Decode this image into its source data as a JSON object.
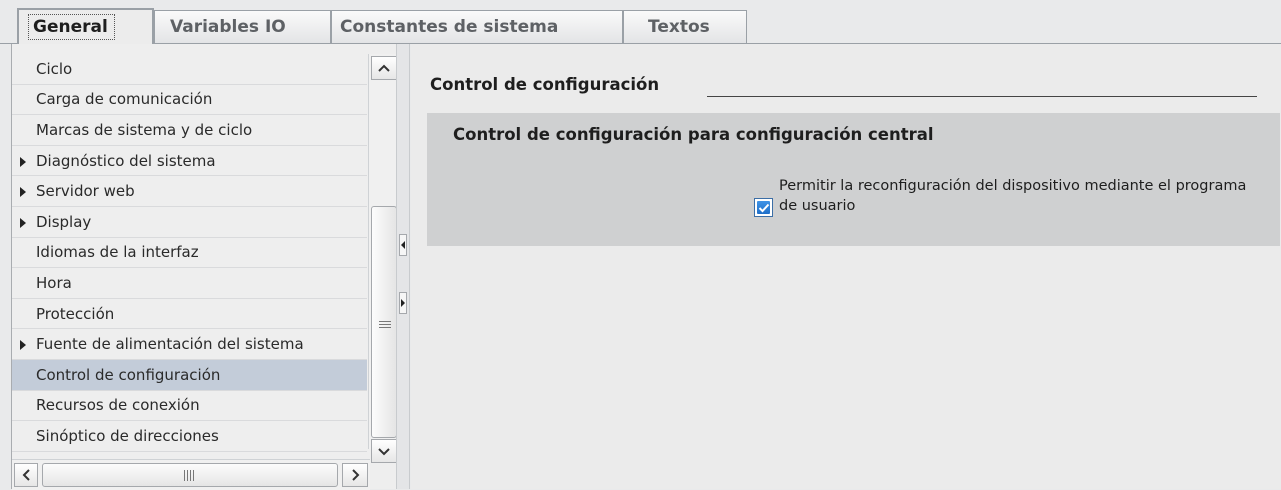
{
  "tabs": [
    {
      "label": "General",
      "active": true
    },
    {
      "label": "Variables IO",
      "active": false
    },
    {
      "label": "Constantes de sistema",
      "active": false
    },
    {
      "label": "Textos",
      "active": false
    }
  ],
  "nav": {
    "items": [
      {
        "label": "Ciclo",
        "expandable": false,
        "selected": false
      },
      {
        "label": "Carga de comunicación",
        "expandable": false,
        "selected": false
      },
      {
        "label": "Marcas de sistema y de ciclo",
        "expandable": false,
        "selected": false
      },
      {
        "label": "Diagnóstico del sistema",
        "expandable": true,
        "selected": false
      },
      {
        "label": "Servidor web",
        "expandable": true,
        "selected": false
      },
      {
        "label": "Display",
        "expandable": true,
        "selected": false
      },
      {
        "label": "Idiomas de la interfaz",
        "expandable": false,
        "selected": false
      },
      {
        "label": "Hora",
        "expandable": false,
        "selected": false
      },
      {
        "label": "Protección",
        "expandable": false,
        "selected": false
      },
      {
        "label": "Fuente de alimentación del sistema",
        "expandable": true,
        "selected": false
      },
      {
        "label": "Control de configuración",
        "expandable": false,
        "selected": true
      },
      {
        "label": "Recursos de conexión",
        "expandable": false,
        "selected": false
      },
      {
        "label": "Sinóptico de direcciones",
        "expandable": false,
        "selected": false
      }
    ]
  },
  "content": {
    "section_title": "Control de configuración",
    "group_title": "Control de configuración para configuración central",
    "checkbox": {
      "checked": true,
      "label": "Permitir la reconfiguración del dispositivo mediante el programa de usuario"
    }
  },
  "colors": {
    "selection": "#c3ccd9",
    "group_background": "#cfd0d1",
    "checkbox_fill": "#2f80d8"
  },
  "icons": [
    "scroll-up-icon",
    "scroll-down-icon",
    "scroll-left-icon",
    "scroll-right-icon",
    "grip-icon",
    "expand-arrow-icon",
    "checkmark-icon",
    "collapse-left-icon",
    "expand-right-icon"
  ]
}
